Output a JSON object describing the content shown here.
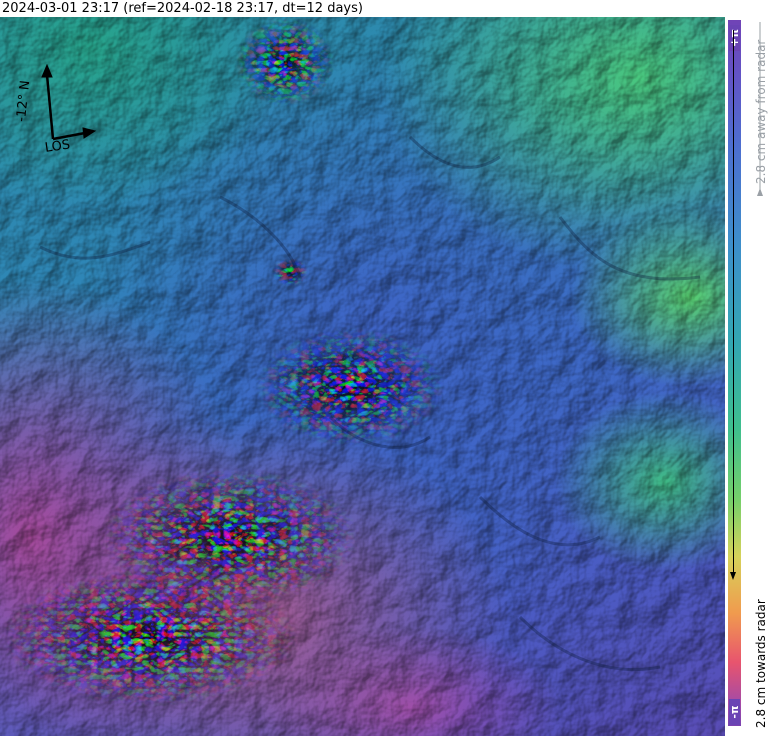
{
  "header": {
    "title": "2024-03-01 23:17 (ref=2024-02-18 23:17, dt=12 days)"
  },
  "map": {
    "north_arrow_label": "-12° N",
    "los_label": "LOS"
  },
  "colorbar": {
    "top_label": "+π",
    "bottom_label": "-π",
    "away_text": "2.8 cm away from radar",
    "towards_text": "2.8 cm towards radar",
    "colors": [
      "#7043b6",
      "#4d6fd0",
      "#33a7b2",
      "#76d06a",
      "#f09b4e",
      "#e8546e",
      "#a24aa8"
    ]
  }
}
